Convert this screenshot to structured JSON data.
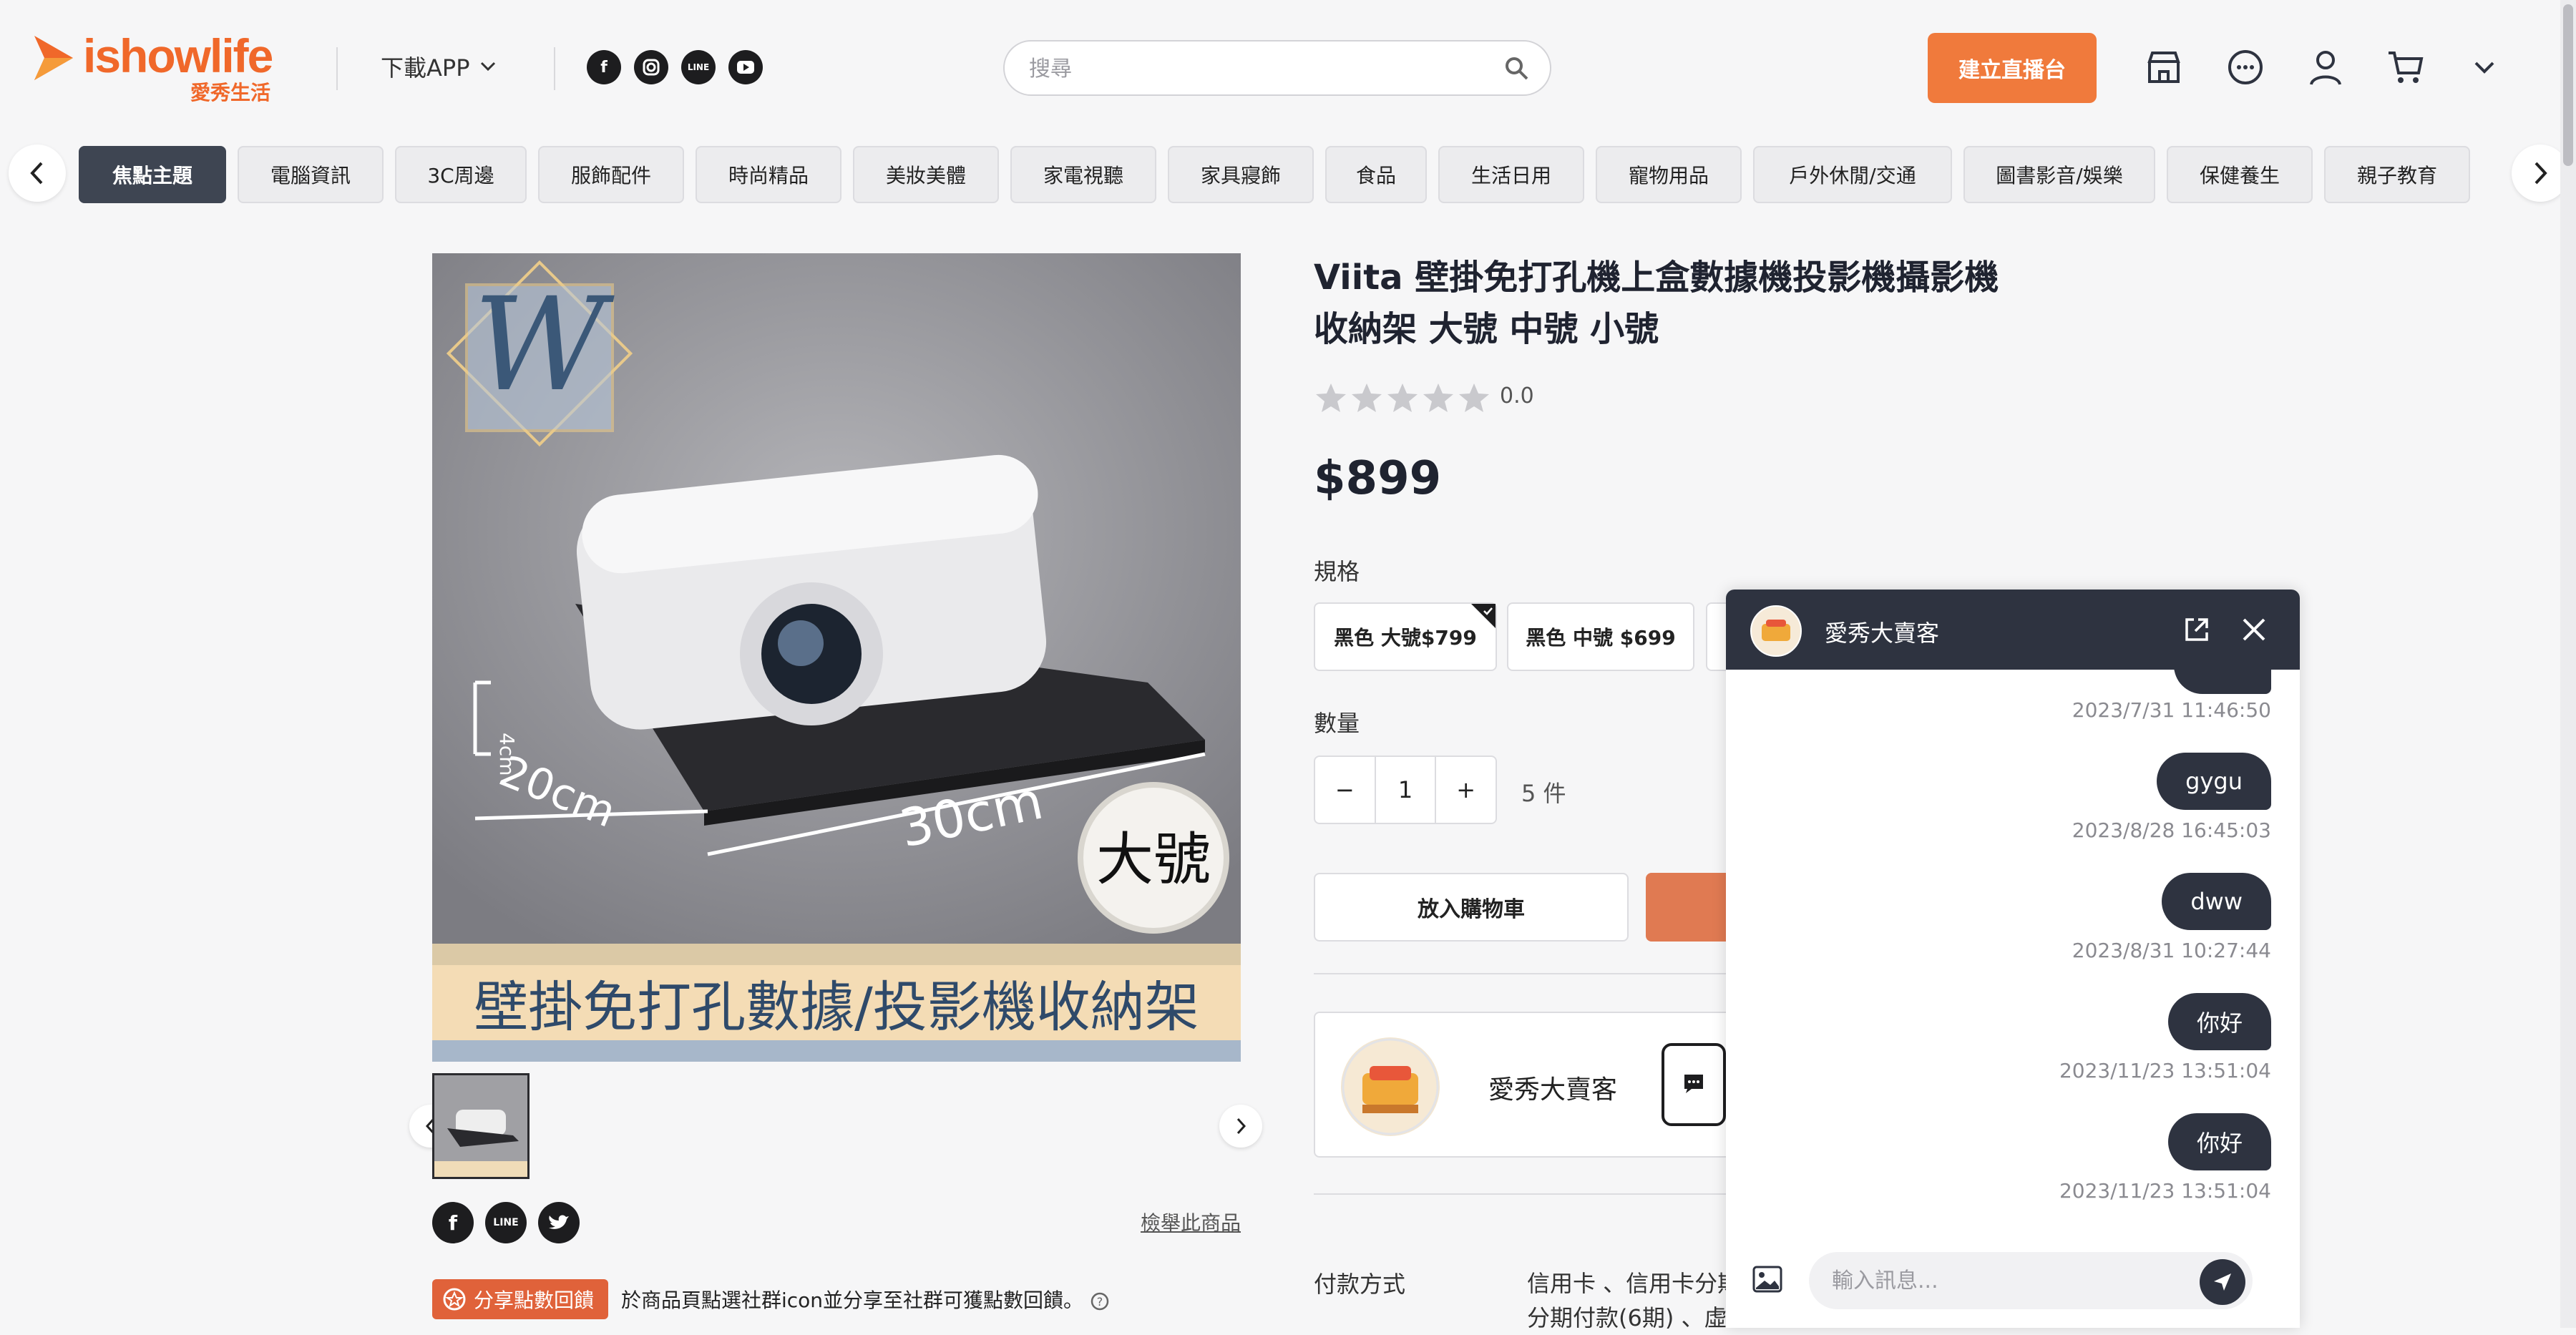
{
  "header": {
    "brand": "ishowlife",
    "brand_sub": "愛秀生活",
    "download_label": "下載APP",
    "social": [
      "f",
      "ig",
      "LINE",
      "▶"
    ],
    "search_placeholder": "搜尋",
    "live_button": "建立直播台"
  },
  "categories": [
    "焦點主題",
    "電腦資訊",
    "3C周邊",
    "服飾配件",
    "時尚精品",
    "美妝美體",
    "家電視聽",
    "家具寢飾",
    "食品",
    "生活日用",
    "寵物用品",
    "戶外休閒/交通",
    "圖書影音/娛樂",
    "保健養生",
    "親子教育"
  ],
  "product": {
    "title": "Viita 壁掛免打孔機上盒數據機投影機攝影機收納架 大號 中號 小號",
    "rating": "0.0",
    "price": "$899",
    "spec_label": "規格",
    "specs": [
      "黑色 大號$799",
      "黑色 中號 $699"
    ],
    "qty_label": "數量",
    "qty_minus": "−",
    "qty_value": "1",
    "qty_plus": "+",
    "stock": "5 件",
    "add_to_cart": "放入購物車",
    "seller_name": "愛秀大賣客",
    "payment_label": "付款方式",
    "payment_value_1": "信用卡 、信用卡分期",
    "payment_value_2": "分期付款(6期) 、虛",
    "report_link": "檢舉此商品",
    "share_badge": "分享點數回饋",
    "share_text": "於商品頁點選社群icon並分享至社群可獲點數回饋。",
    "image_caption": "壁掛免打孔數據/投影機收納架",
    "image_badge": "大號",
    "image_dim_1": "20cm",
    "image_dim_2": "30cm",
    "image_dim_3": "4cm"
  },
  "chat": {
    "title": "愛秀大賣客",
    "messages": [
      {
        "text": "gygu",
        "time": "2023/8/28 16:45:03"
      },
      {
        "text": "dww",
        "time": "2023/8/31 10:27:44"
      },
      {
        "text": "你好",
        "time": "2023/11/23 13:51:04"
      },
      {
        "text": "你好",
        "time": "2023/11/23 13:51:04"
      }
    ],
    "first_time": "2023/7/31 11:46:50",
    "input_placeholder": "輸入訊息..."
  },
  "colors": {
    "accent": "#f07a3c",
    "dark": "#2e3340",
    "active_cat": "#3e4552"
  }
}
